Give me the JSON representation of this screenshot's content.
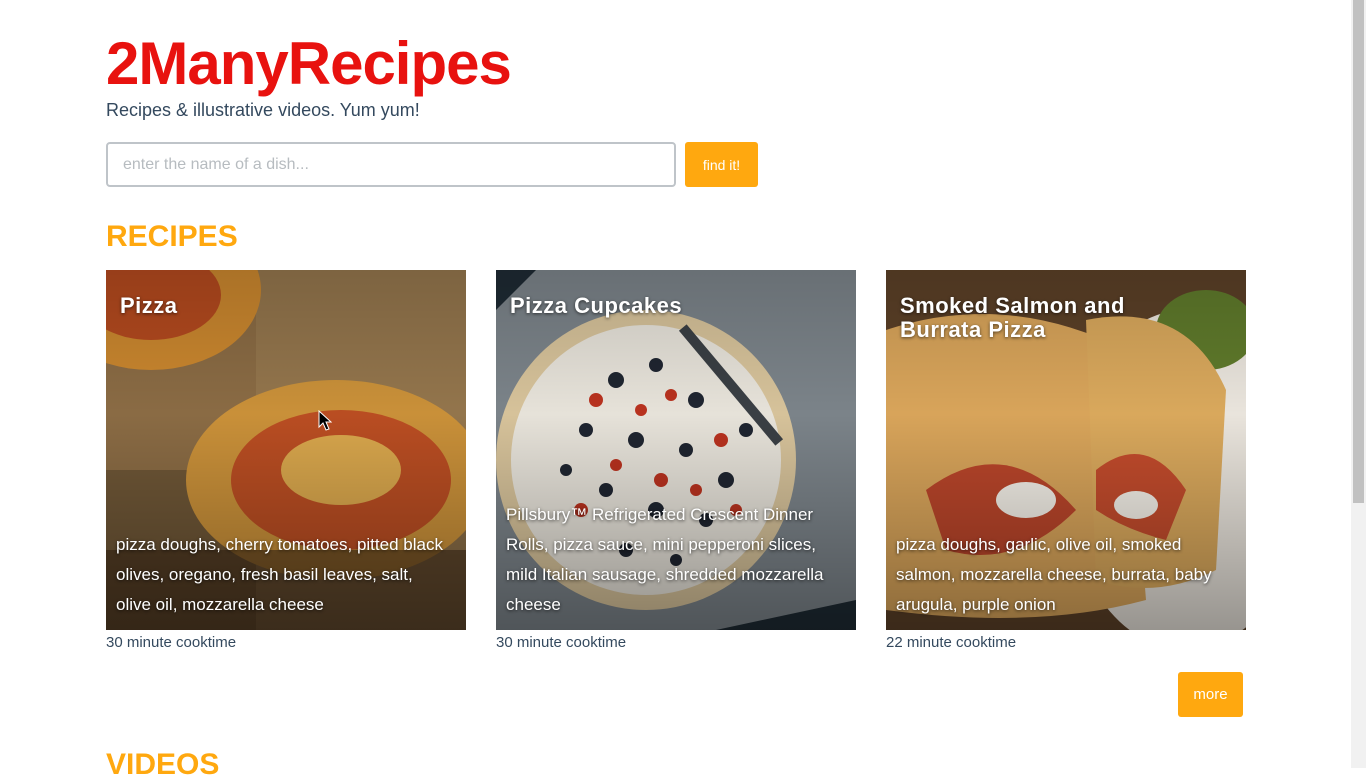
{
  "header": {
    "brand": "2ManyRecipes",
    "tagline": "Recipes & illustrative videos. Yum yum!"
  },
  "search": {
    "placeholder": "enter the name of a dish...",
    "value": "",
    "button_label": "find it!"
  },
  "sections": {
    "recipes_title": "RECIPES",
    "videos_title": "VIDEOS"
  },
  "recipes": [
    {
      "title": "Pizza",
      "ingredients": "pizza doughs, cherry tomatoes, pitted black olives, oregano, fresh basil leaves, salt, olive oil, mozzarella cheese",
      "cooktime": "30 minute cooktime"
    },
    {
      "title": "Pizza Cupcakes",
      "ingredients": "Pillsbury™ Refrigerated Crescent Dinner Rolls, pizza sauce, mini pepperoni slices, mild Italian sausage, shredded mozzarella cheese",
      "cooktime": "30 minute cooktime"
    },
    {
      "title": "Smoked Salmon and Burrata Pizza",
      "ingredients": "pizza doughs, garlic, olive oil, smoked salmon, mozzarella cheese, burrata, baby arugula, purple onion",
      "cooktime": "22 minute cooktime"
    }
  ],
  "more_label": "more",
  "colors": {
    "brand": "#e8120f",
    "accent": "#ffa80f",
    "text": "#34495e"
  }
}
